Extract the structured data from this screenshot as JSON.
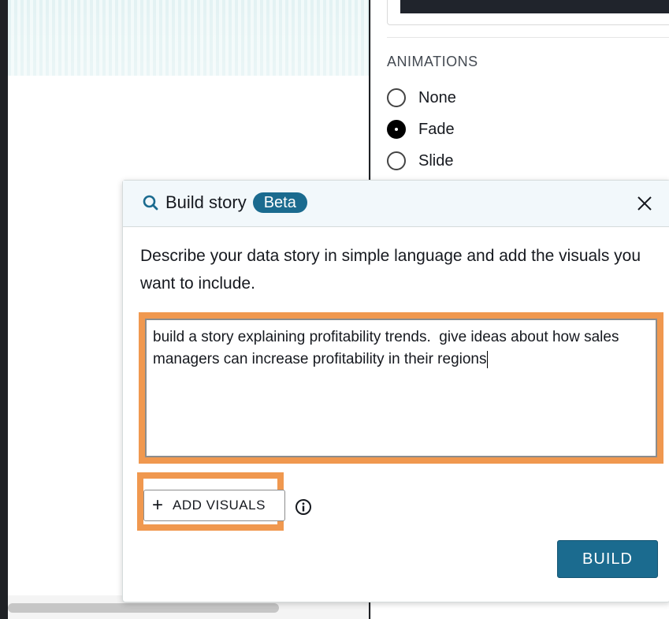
{
  "settings_panel": {
    "animations_title": "ANIMATIONS",
    "animation_options": [
      {
        "label": "None",
        "checked": false
      },
      {
        "label": "Fade",
        "checked": true
      },
      {
        "label": "Slide",
        "checked": false
      }
    ]
  },
  "dialog": {
    "title": "Build story",
    "badge": "Beta",
    "description": "Describe your data story in simple language and add the visuals you want to include.",
    "prompt_text": "build a story explaining profitability trends.  give ideas about how sales managers can increase profitability in their regions",
    "add_visuals_label": "ADD VISUALS",
    "build_label": "BUILD",
    "icons": {
      "title_icon": "search-icon",
      "close": "close-icon",
      "add": "plus-icon",
      "info": "info-icon"
    }
  },
  "colors": {
    "accent": "#1b6b8f",
    "highlight": "#f0984f",
    "header_bg": "#f2f8fb"
  }
}
